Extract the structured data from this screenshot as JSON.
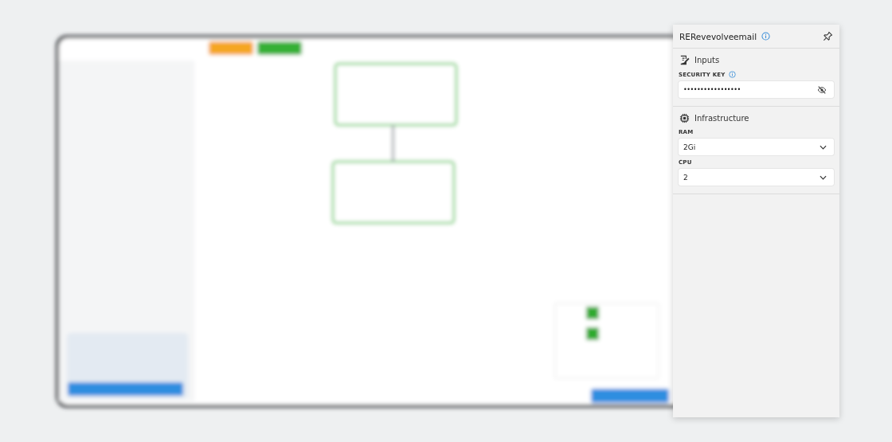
{
  "panel": {
    "title": "RERevevolveemail",
    "sections": [
      {
        "kind": "inputs",
        "title": "Inputs",
        "fields": [
          {
            "kind": "secret",
            "label": "SECURITY KEY",
            "info": true,
            "value": "•••••••••••••••••"
          }
        ]
      },
      {
        "kind": "infrastructure",
        "title": "Infrastructure",
        "fields": [
          {
            "kind": "select",
            "label": "RAM",
            "info": false,
            "value": "2Gi"
          },
          {
            "kind": "select",
            "label": "CPU",
            "info": false,
            "value": "2"
          }
        ]
      }
    ]
  }
}
